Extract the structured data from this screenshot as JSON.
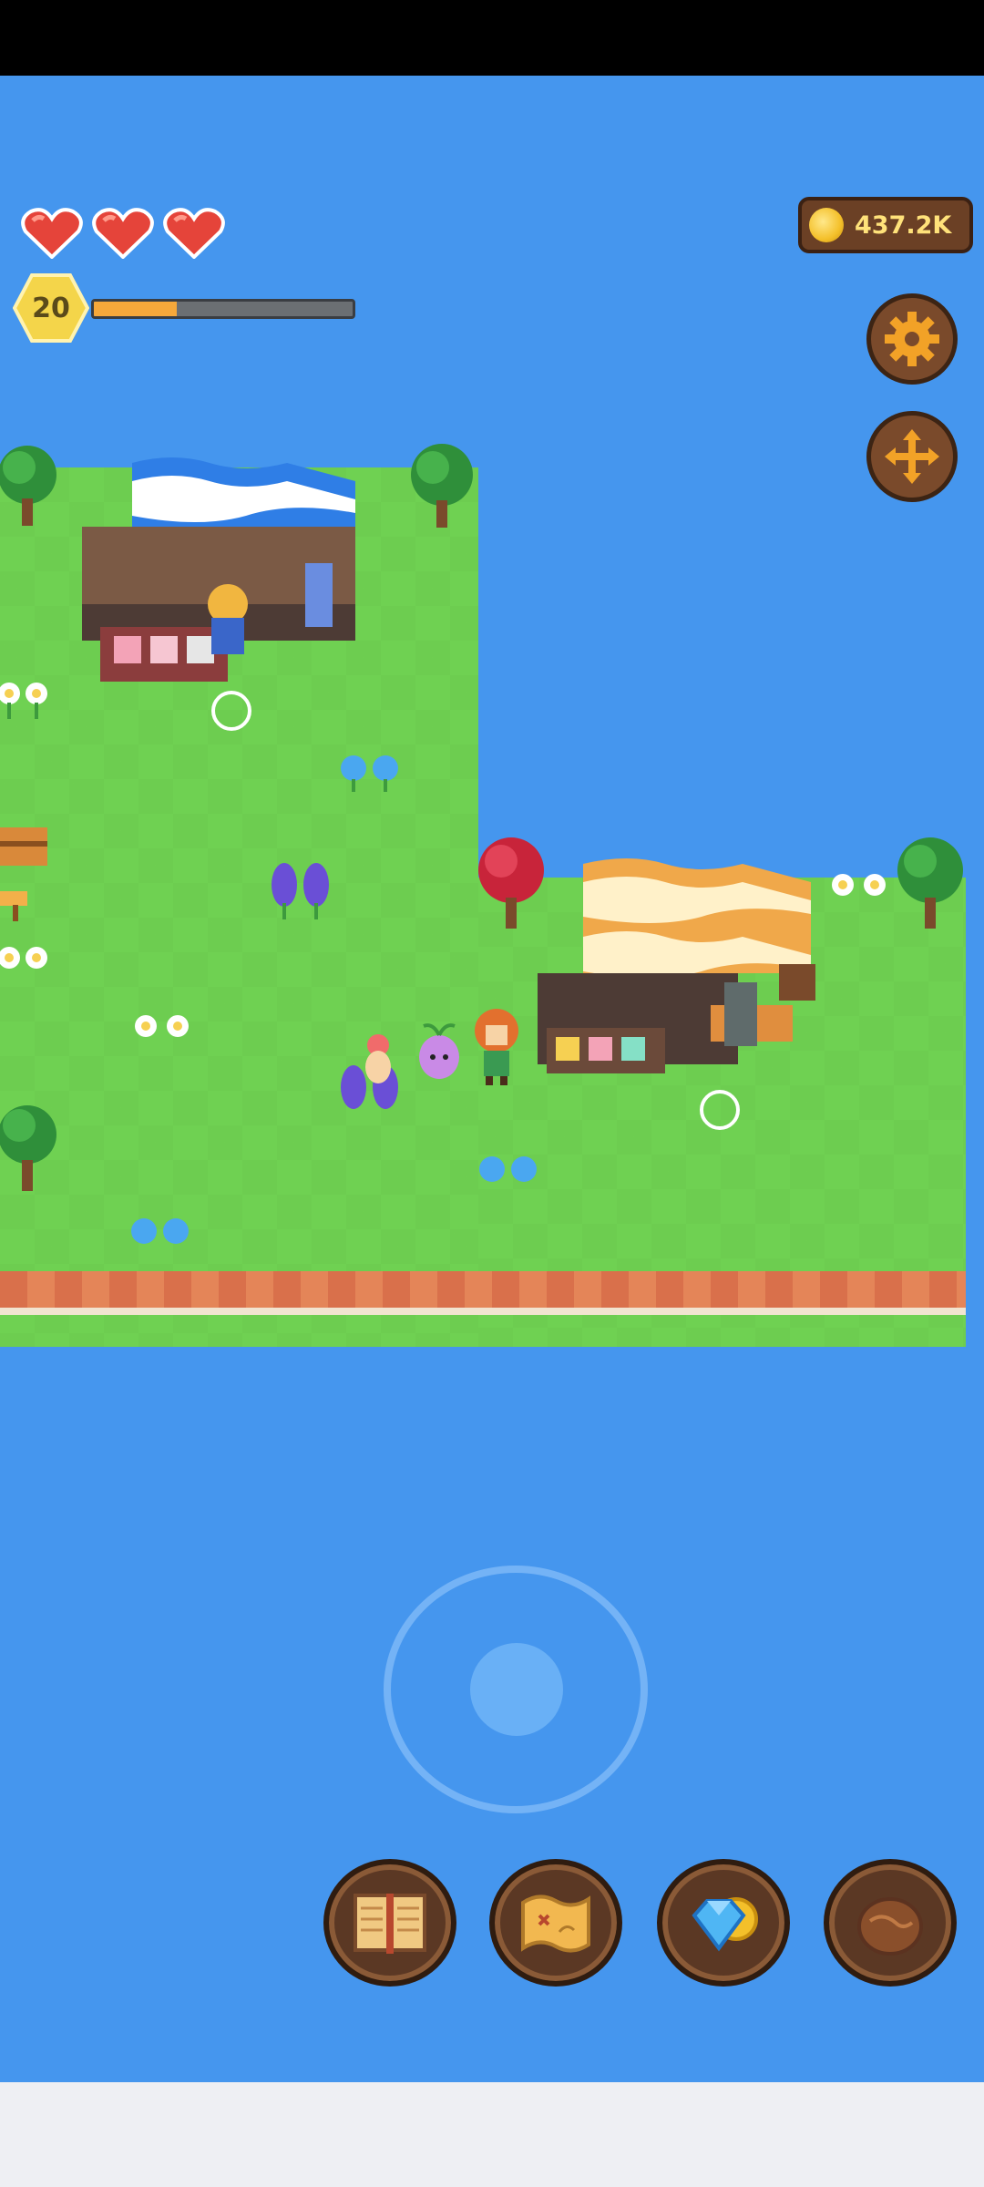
{
  "hud": {
    "hearts": [
      {
        "icon": "heart-icon",
        "state": "full"
      },
      {
        "icon": "heart-icon",
        "state": "full"
      },
      {
        "icon": "heart-icon",
        "state": "full"
      }
    ],
    "level": "20",
    "xp_progress": 0.32,
    "coins": "437.2K"
  },
  "buttons": {
    "settings_icon": "gear-icon",
    "move_icon": "move-arrows-icon",
    "actions": [
      {
        "icon": "book-icon"
      },
      {
        "icon": "map-scroll-icon"
      },
      {
        "icon": "gem-shop-icon"
      },
      {
        "icon": "resource-bag-icon"
      }
    ]
  },
  "colors": {
    "water": "#4596ee",
    "grass": "#6fd152",
    "cliff": "#d9704b",
    "heart": "#e5443a",
    "level_badge": "#f4d54a",
    "xp_fill": "#f6a83a",
    "coin_text": "#ffe27a",
    "button_wood": "#7a4a2b",
    "gear": "#f2a227"
  }
}
